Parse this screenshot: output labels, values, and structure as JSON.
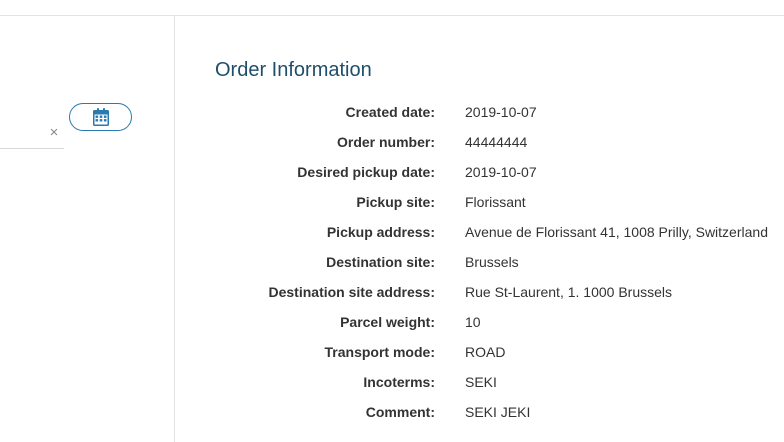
{
  "left_panel": {
    "date_input": {
      "value": "",
      "clear_symbol": "×"
    },
    "calendar_button": {
      "icon": "calendar-icon",
      "color": "#2a7ab0"
    }
  },
  "order_info": {
    "title": "Order Information",
    "rows": [
      {
        "label": "Created date:",
        "value": "2019-10-07"
      },
      {
        "label": "Order number:",
        "value": "44444444"
      },
      {
        "label": "Desired pickup date:",
        "value": "2019-10-07"
      },
      {
        "label": "Pickup site:",
        "value": "Florissant"
      },
      {
        "label": "Pickup address:",
        "value": "Avenue de Florissant 41, 1008 Prilly, Switzerland"
      },
      {
        "label": "Destination site:",
        "value": "Brussels"
      },
      {
        "label": "Destination site address:",
        "value": "Rue St-Laurent, 1. 1000 Brussels"
      },
      {
        "label": "Parcel weight:",
        "value": "10"
      },
      {
        "label": "Transport mode:",
        "value": "ROAD"
      },
      {
        "label": "Incoterms:",
        "value": "SEKI"
      },
      {
        "label": "Comment:",
        "value": "SEKI JEKI"
      }
    ]
  },
  "colors": {
    "title": "#1f4e6b",
    "accent": "#2a7ab0",
    "divider": "#e3e3e3"
  }
}
